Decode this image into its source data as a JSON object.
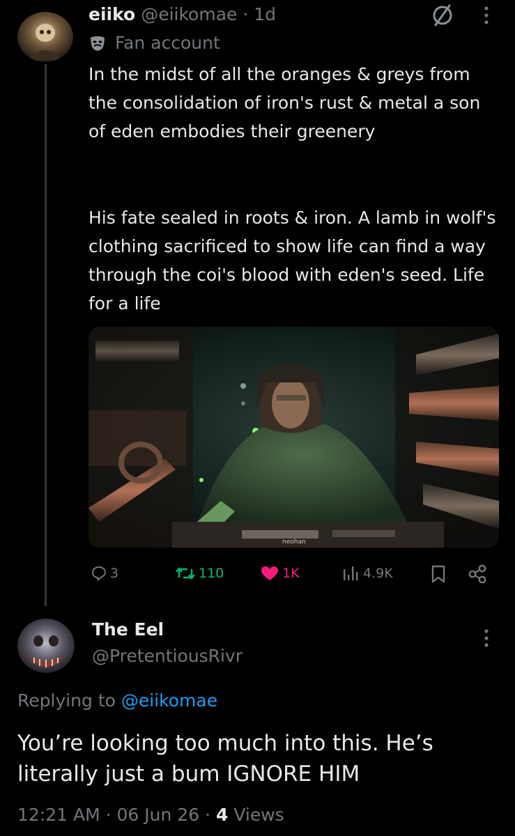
{
  "tweet": {
    "display_name": "eiiko",
    "handle": "@eiikomae",
    "separator": "·",
    "age": "1d",
    "badge_label": "Fan account",
    "paragraph_1": "In the midst of all the oranges & greys from the consolidation of iron's rust & metal a son of eden embodies their greenery",
    "paragraph_2": "His fate sealed in roots & iron. A lamb in wolf's clothing sacrificed to show life can find a way through the coi's blood with eden's seed. Life for a life",
    "media_watermark": "neohan",
    "stats": {
      "replies": "3",
      "reposts": "110",
      "likes": "1K",
      "views": "4.9K"
    },
    "colors": {
      "repost": "#00ba7c",
      "like": "#f91880"
    }
  },
  "reply": {
    "display_name": "The Eel",
    "handle": "@PretentiousRivr",
    "replying_prefix": "Replying to",
    "replying_handle": "@eiikomae",
    "text": "You’re looking too much into this. He’s literally just a bum IGNORE HIM",
    "time": "12:21 AM",
    "sep1": "·",
    "date": "06 Jun 26",
    "sep2": "·",
    "views_count": "4",
    "views_label": "Views",
    "link_color": "#1d9bf0"
  }
}
